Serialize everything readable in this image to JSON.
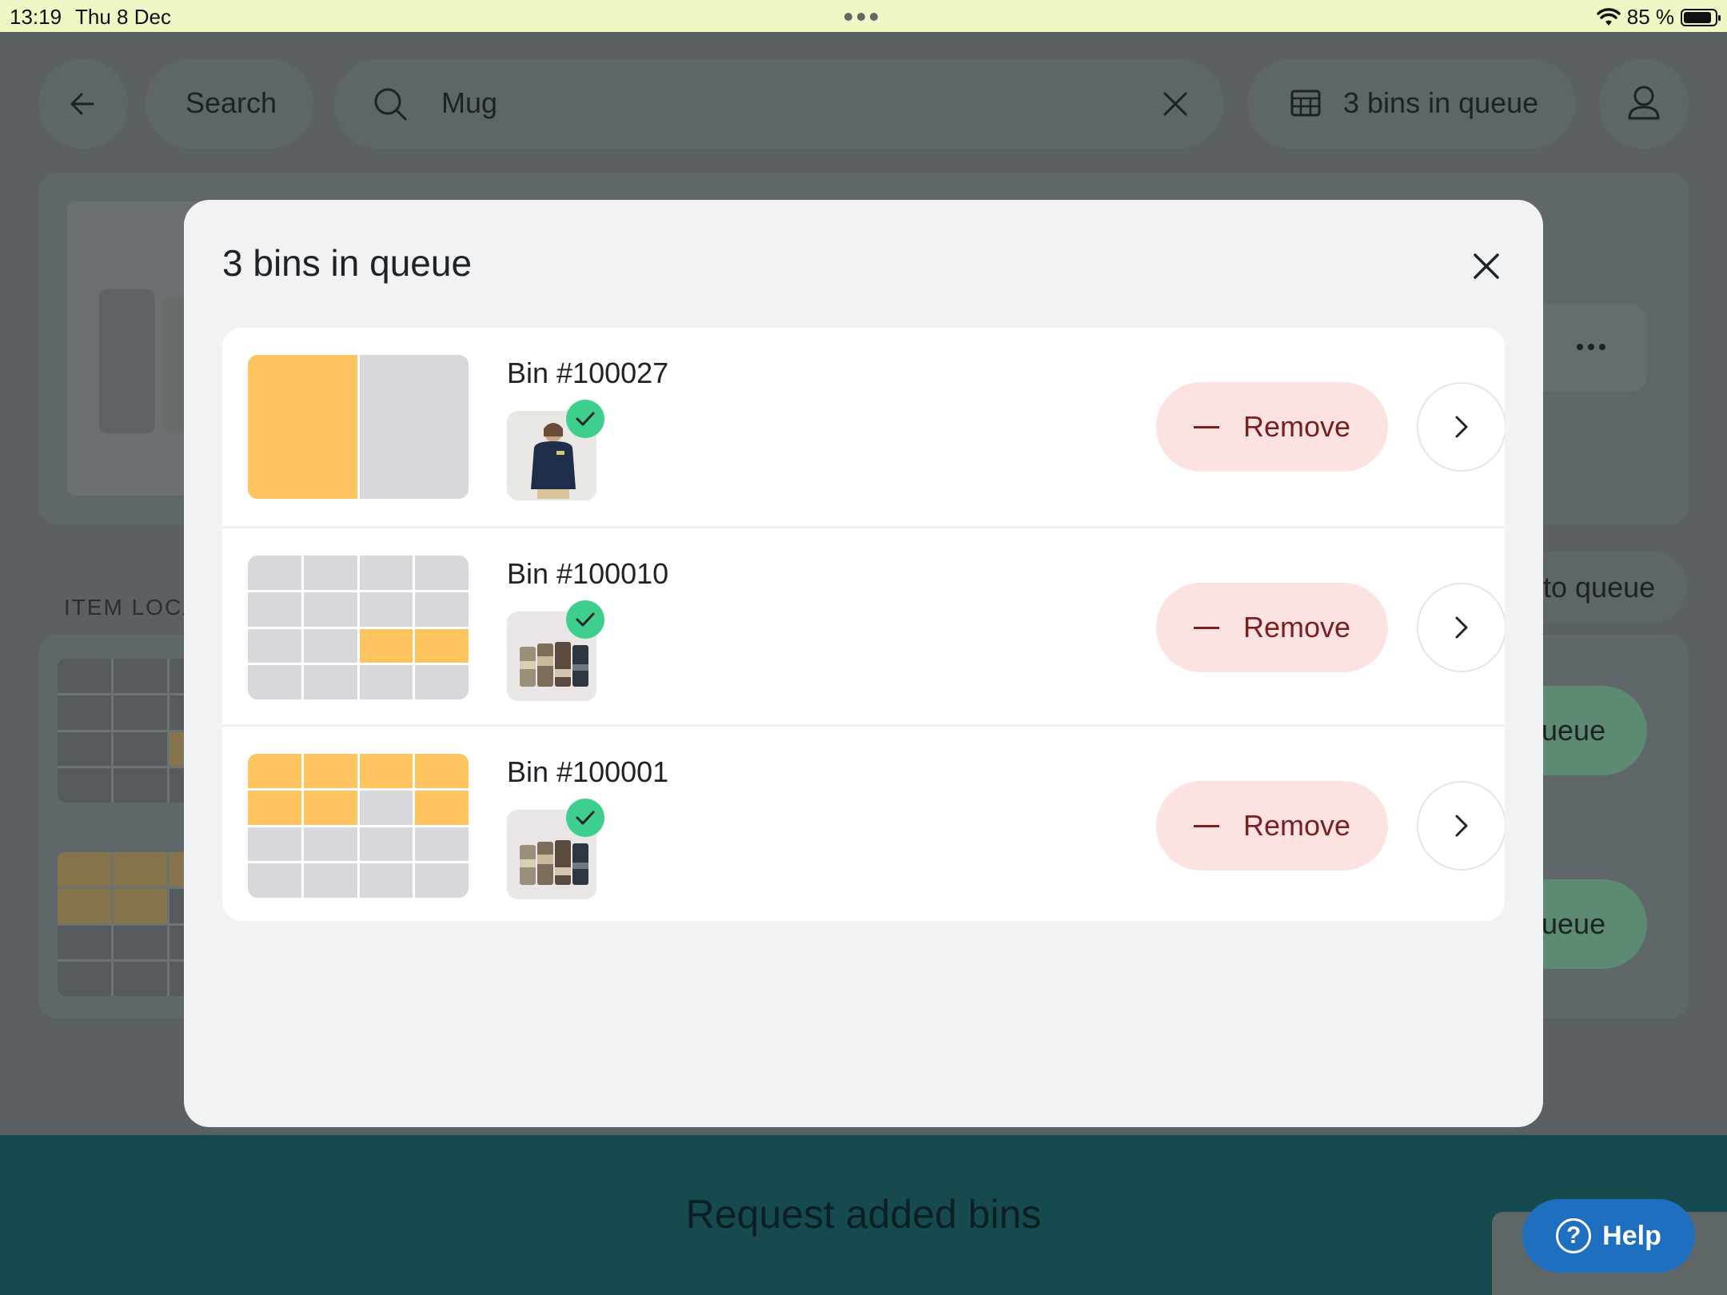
{
  "status_bar": {
    "time": "13:19",
    "date": "Thu 8 Dec",
    "battery": "85 %",
    "battery_level": 0.85
  },
  "header": {
    "search_label": "Search",
    "search_query": "Mug",
    "queue_label": "3 bins in queue"
  },
  "background": {
    "section_label": "ITEM LOCA",
    "add_to_queue_label": "to queue",
    "queue_button_1": "ueue",
    "queue_button_2": "ueue"
  },
  "bottom_bar": {
    "label": "Request added bins"
  },
  "help": {
    "label": "Help"
  },
  "modal": {
    "title": "3 bins in queue",
    "bins": [
      {
        "name": "Bin #100027",
        "remove_label": "Remove",
        "grid_cols": 2,
        "grid_rows": 1,
        "filled_cells": [
          0
        ],
        "item_image": "sweatshirt-photo"
      },
      {
        "name": "Bin #100010",
        "remove_label": "Remove",
        "grid_cols": 4,
        "grid_rows": 4,
        "filled_cells": [
          10,
          11
        ],
        "item_image": "mugs-photo"
      },
      {
        "name": "Bin #100001",
        "remove_label": "Remove",
        "grid_cols": 4,
        "grid_rows": 4,
        "filled_cells": [
          0,
          1,
          2,
          3,
          4,
          5,
          7
        ],
        "item_image": "mugs-photo"
      }
    ]
  },
  "colors": {
    "accent_yellow": "#fdc45f",
    "empty_cell": "#d6d8dc",
    "remove_bg": "#fde2e2",
    "remove_text": "#7a1f1f",
    "check_green": "#3ecf8e",
    "bottom_bar": "#164a4e",
    "help_blue": "#1f6fc0"
  }
}
